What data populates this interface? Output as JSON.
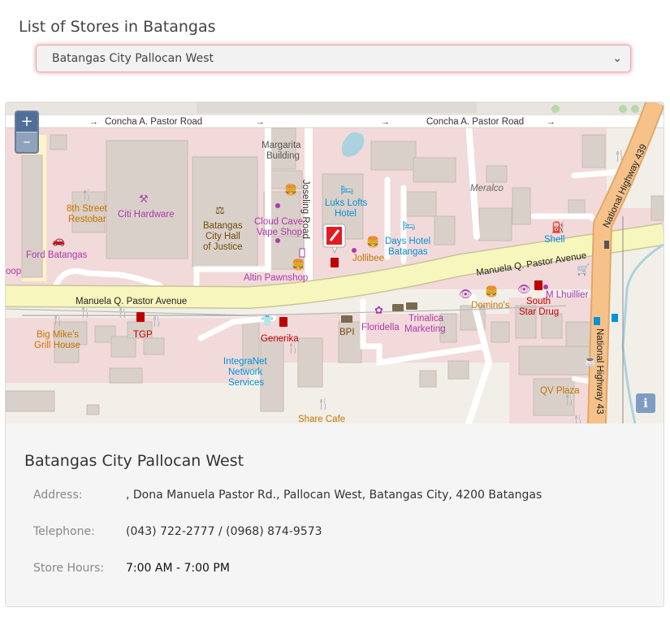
{
  "page": {
    "title": "List of Stores in Batangas"
  },
  "store_select": {
    "selected": "Batangas City Pallocan West"
  },
  "map": {
    "zoom_in": "+",
    "zoom_out": "–",
    "info": "i",
    "labels": {
      "concha_road_left": "Concha A. Pastor Road",
      "concha_road_right": "Concha A. Pastor Road",
      "margarita": [
        "Margarita",
        "Building"
      ],
      "joseling": "Joseling Road",
      "luks": [
        "Luks Lofts",
        "Hotel"
      ],
      "meralco": "Meralco",
      "national_highway_top": "National Highway 439",
      "street8": [
        "8th Street",
        "Restobar"
      ],
      "citi": "Citi Hardware",
      "hall": [
        "Batangas",
        "City Hall",
        "of Justice"
      ],
      "cloud": [
        "Cloud Cave",
        "Vape Shop"
      ],
      "days": [
        "Days Hotel",
        "Batangas"
      ],
      "shell": "Shell",
      "ford": "Ford Batangas",
      "oop": "oop",
      "jollibee": "Jollibee",
      "altin": "Altin Pawnshop",
      "mqp_right": "Manuela Q. Pastor Avenue",
      "mqp_left": "Manuela Q. Pastor Avenue",
      "mlhuillier": "M Lhuillier",
      "dominos": "Domino's",
      "south": [
        "South",
        "Star Drug"
      ],
      "bigmikes": [
        "Big Mike's",
        "Grill House"
      ],
      "tgp": "TGP",
      "generika": "Generika",
      "bpi": "BPI",
      "floridella": "Floridella",
      "trinalica": [
        "Trinalica",
        "Marketing"
      ],
      "integranet": [
        "IntegraNet",
        "Network",
        "Services"
      ],
      "national_highway_bottom": "National Highway 43",
      "qvplaza": "QV Plaza",
      "sharecafe": "Share Cafe"
    }
  },
  "store": {
    "name": "Batangas City Pallocan West",
    "address_label": "Address:",
    "address": ", Dona Manuela Pastor Rd., Pallocan West, Batangas City, 4200 Batangas",
    "telephone_label": "Telephone:",
    "telephone": "(043) 722-2777 / (0968) 874-9573",
    "hours_label": "Store Hours:",
    "hours": "7:00 AM - 7:00 PM"
  }
}
